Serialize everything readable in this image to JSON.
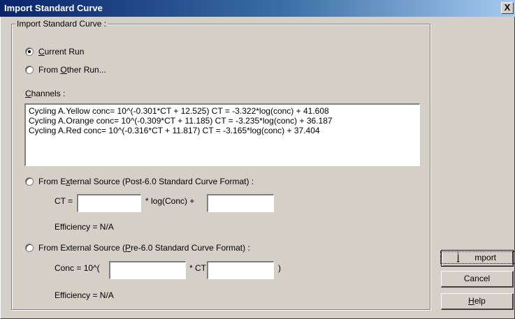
{
  "window": {
    "title": "Import Standard Curve",
    "close_label": "X"
  },
  "group": {
    "legend": "Import Standard Curve :"
  },
  "options": {
    "current_run": {
      "label_prefix": "",
      "mnemonic": "C",
      "label_rest": "urrent Run",
      "checked": true
    },
    "other_run": {
      "label_prefix": "From ",
      "mnemonic": "O",
      "label_rest": "ther Run...",
      "checked": false
    },
    "external_post": {
      "label_prefix": "From E",
      "mnemonic": "x",
      "label_rest": "ternal Source (Post-6.0 Standard Curve Format) :",
      "checked": false
    },
    "external_pre": {
      "label_prefix": "From External Source (",
      "mnemonic": "P",
      "label_rest": "re-6.0 Standard Curve Format) :",
      "checked": false
    }
  },
  "channels": {
    "label_mnemonic": "C",
    "label_rest": "hannels :",
    "items": [
      "Cycling A.Yellow  conc= 10^(-0.301*CT + 12.525)  CT = -3.322*log(conc) + 41.608",
      "Cycling A.Orange  conc= 10^(-0.309*CT + 11.185)  CT = -3.235*log(conc) + 36.187",
      "Cycling A.Red  conc= 10^(-0.316*CT + 11.817)  CT = -3.165*log(conc) + 37.404"
    ]
  },
  "post_format": {
    "ct_label": "CT =",
    "middle_label": "* log(Conc) +",
    "slope_value": "",
    "intercept_value": "",
    "efficiency": "Efficiency = N/A"
  },
  "pre_format": {
    "conc_label": "Conc = 10^(",
    "middle_label": "* CT +",
    "close_label": ")",
    "slope_value": "",
    "intercept_value": "",
    "efficiency": "Efficiency = N/A"
  },
  "buttons": {
    "import_mnemonic": "I",
    "import_rest": "mport",
    "cancel": "Cancel",
    "help_mnemonic": "H",
    "help_rest": "elp"
  }
}
